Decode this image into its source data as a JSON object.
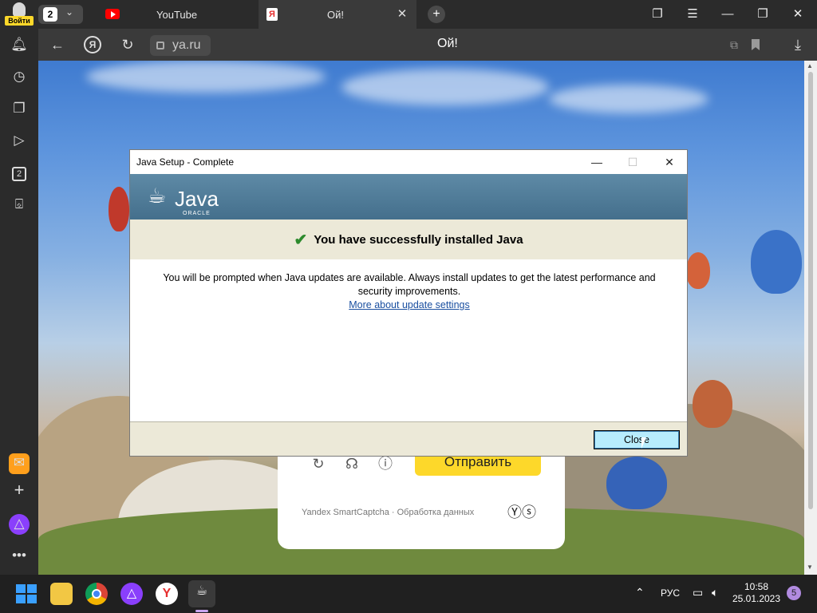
{
  "browser": {
    "profile_label": "Войти",
    "tab_count": "2",
    "tabs": [
      {
        "label": "YouTube"
      },
      {
        "label": "Ой!"
      }
    ],
    "url": "ya.ru",
    "page_title": "Ой!"
  },
  "captcha": {
    "send_label": "Отправить",
    "footer": "Yandex SmartCaptcha · Обработка данных"
  },
  "dialog": {
    "title": "Java Setup - Complete",
    "java_word": "Java",
    "oracle_word": "ORACLE",
    "heading": "You have successfully installed Java",
    "body": "You will be prompted when Java updates are available. Always install updates to get the latest performance and security improvements.",
    "link": "More about update settings",
    "close_label": "Close"
  },
  "taskbar": {
    "lang": "РУС",
    "time": "10:58",
    "date": "25.01.2023",
    "notifications": "5"
  },
  "colors": {
    "java_banner": "#4f7e9c",
    "dialog_panel": "#ece9d8",
    "close_button": "#b7ecfc",
    "captcha_send": "#fdd82a",
    "checkmark": "#2d8a2d"
  }
}
